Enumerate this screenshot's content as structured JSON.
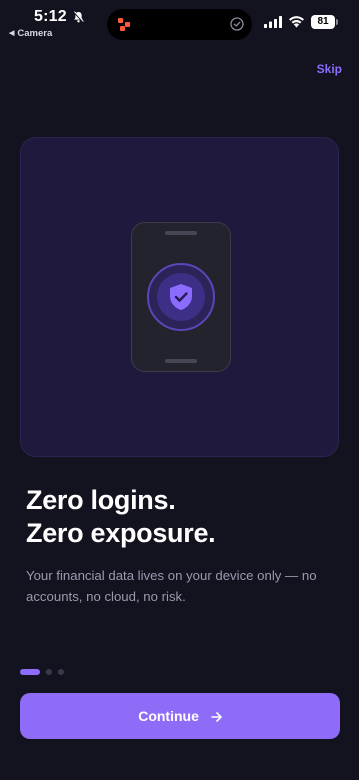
{
  "status_bar": {
    "time": "5:12",
    "back_app": "Camera",
    "battery": "81"
  },
  "header": {
    "skip_label": "Skip"
  },
  "hero": {
    "illustration": "phone-with-shield-check"
  },
  "content": {
    "headline_line1": "Zero logins.",
    "headline_line2": "Zero exposure.",
    "body": "Your financial data lives on your device only — no accounts, no cloud, no risk."
  },
  "pager": {
    "total_pages": 3,
    "active_index": 0
  },
  "footer": {
    "continue_label": "Continue"
  },
  "colors": {
    "background": "#13131f",
    "accent": "#8f6cf7",
    "card": "#1f1a3d",
    "body_text": "#9a9aae"
  }
}
